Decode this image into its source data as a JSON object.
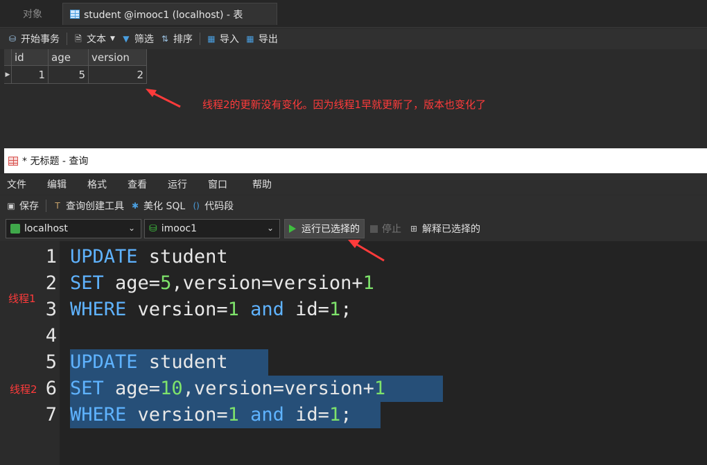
{
  "tabs": {
    "inactive": "对象",
    "active": "student @imooc1 (localhost) - 表"
  },
  "table_toolbar": {
    "begin_tx": "开始事务",
    "text": "文本",
    "filter": "筛选",
    "sort": "排序",
    "import": "导入",
    "export": "导出"
  },
  "table": {
    "columns": [
      "id",
      "age",
      "version"
    ],
    "rows": [
      [
        "1",
        "5",
        "2"
      ]
    ]
  },
  "annotations": {
    "table_note": "线程2的更新没有变化。因为线程1早就更新了，版本也变化了",
    "thread1": "线程1",
    "thread2": "线程2"
  },
  "query_window": {
    "title": "* 无标题 - 查询",
    "menu": [
      "文件",
      "编辑",
      "格式",
      "查看",
      "运行",
      "窗口",
      "帮助"
    ],
    "toolbar": {
      "save": "保存",
      "query_builder": "查询创建工具",
      "beautify": "美化 SQL",
      "snippet": "代码段"
    },
    "connection": "localhost",
    "database": "imooc1",
    "run_selected": "运行已选择的",
    "stop": "停止",
    "explain_selected": "解释已选择的"
  },
  "code_lines": [
    {
      "n": "1",
      "tokens": [
        [
          "kw",
          "UPDATE"
        ],
        [
          "id",
          " student"
        ]
      ]
    },
    {
      "n": "2",
      "tokens": [
        [
          "kw",
          "SET"
        ],
        [
          "id",
          " age="
        ],
        [
          "nm",
          "5"
        ],
        [
          "id",
          ",version=version+"
        ],
        [
          "nm",
          "1"
        ]
      ]
    },
    {
      "n": "3",
      "tokens": [
        [
          "kw",
          "WHERE"
        ],
        [
          "id",
          " version="
        ],
        [
          "nm",
          "1"
        ],
        [
          "id",
          " "
        ],
        [
          "kw",
          "and"
        ],
        [
          "id",
          " id="
        ],
        [
          "nm",
          "1"
        ],
        [
          "id",
          ";"
        ]
      ]
    },
    {
      "n": "4",
      "tokens": []
    },
    {
      "n": "5",
      "tokens": [
        [
          "kw",
          "UPDATE"
        ],
        [
          "id",
          " student"
        ]
      ]
    },
    {
      "n": "6",
      "tokens": [
        [
          "kw",
          "SET"
        ],
        [
          "id",
          " age="
        ],
        [
          "nm",
          "10"
        ],
        [
          "id",
          ",version=version+"
        ],
        [
          "nm",
          "1"
        ]
      ]
    },
    {
      "n": "7",
      "tokens": [
        [
          "kw",
          "WHERE"
        ],
        [
          "id",
          " version="
        ],
        [
          "nm",
          "1"
        ],
        [
          "id",
          " "
        ],
        [
          "kw",
          "and"
        ],
        [
          "id",
          " id="
        ],
        [
          "nm",
          "1"
        ],
        [
          "id",
          ";"
        ]
      ]
    }
  ],
  "colors": {
    "keyword": "#5fb3ff",
    "number": "#7ee36b",
    "selection": "#264f78",
    "annotation": "#ff3b3b"
  }
}
